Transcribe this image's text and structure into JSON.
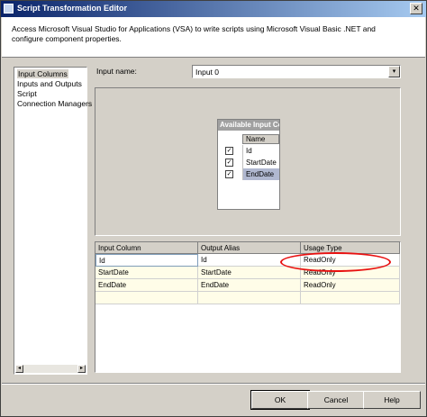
{
  "window": {
    "title": "Script Transformation Editor",
    "close_glyph": "✕"
  },
  "header": {
    "description": "Access Microsoft Visual Studio for Applications (VSA) to write scripts using Microsoft Visual Basic .NET and configure component properties."
  },
  "nav": {
    "items": [
      {
        "label": "Input Columns",
        "selected": true
      },
      {
        "label": "Inputs and Outputs",
        "selected": false
      },
      {
        "label": "Script",
        "selected": false
      },
      {
        "label": "Connection Managers",
        "selected": false
      }
    ],
    "scroll_left": "◂",
    "scroll_right": "▸"
  },
  "input_name": {
    "label": "Input name:",
    "value": "Input 0",
    "dropdown_glyph": "▾"
  },
  "available_columns": {
    "title": "Available Input Co...",
    "header": "Name",
    "check_glyph": "✓",
    "columns": [
      {
        "name": "Id",
        "checked": true
      },
      {
        "name": "StartDate",
        "checked": true
      },
      {
        "name": "EndDate",
        "checked": true
      }
    ]
  },
  "mapping_grid": {
    "headers": [
      "Input Column",
      "Output Alias",
      "Usage Type"
    ],
    "rows": [
      [
        "Id",
        "Id",
        "ReadOnly"
      ],
      [
        "StartDate",
        "StartDate",
        "ReadOnly"
      ],
      [
        "EndDate",
        "EndDate",
        "ReadOnly"
      ]
    ]
  },
  "buttons": {
    "ok": "OK",
    "cancel": "Cancel",
    "help": "Help"
  },
  "colors": {
    "annotation": "#e81010",
    "titlebar_start": "#0a246a"
  }
}
